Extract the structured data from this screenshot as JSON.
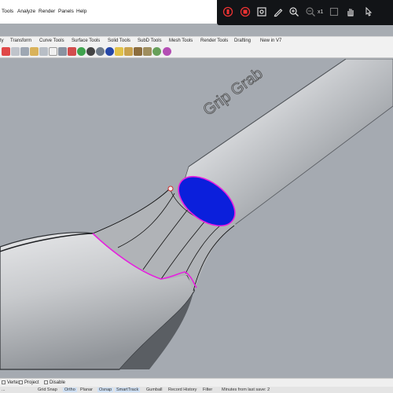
{
  "menu": {
    "items": [
      "Tools",
      "Analyze",
      "Render",
      "Panels",
      "Help"
    ]
  },
  "recorder": {
    "zoom_label": "x1"
  },
  "toolbar_tabs": [
    "ty",
    "Transform",
    "Curve Tools",
    "Surface Tools",
    "Solid Tools",
    "SubD Tools",
    "Mesh Tools",
    "Render Tools",
    "Drafting",
    "New in V7"
  ],
  "viewport": {
    "embossed_text": "Grip Grab"
  },
  "osnap": {
    "items": [
      "Vertex",
      "Project",
      "Disable"
    ]
  },
  "status": {
    "items": [
      "...",
      "Grid Snap",
      "Ortho",
      "Planar",
      "Osnap",
      "SmartTrack",
      "Gumball",
      "Record History",
      "Filter",
      "Minutes from last save: 2"
    ]
  },
  "colors": {
    "viewport_bg": "#a5aab1",
    "selection": "#e81fe0",
    "selected_face": "#0b1fdc",
    "overlay_bg": "#121417"
  }
}
